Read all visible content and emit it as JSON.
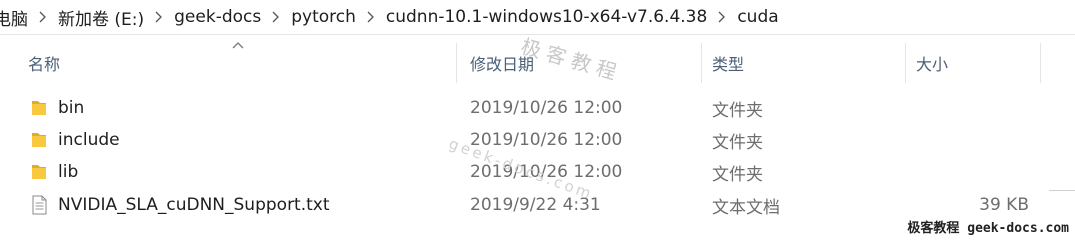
{
  "breadcrumb": [
    {
      "label": "电脑"
    },
    {
      "label": "新加卷 (E:)"
    },
    {
      "label": "geek-docs"
    },
    {
      "label": "pytorch"
    },
    {
      "label": "cudnn-10.1-windows10-x64-v7.6.4.38"
    },
    {
      "label": "cuda"
    }
  ],
  "columns": {
    "name": "名称",
    "modified": "修改日期",
    "type": "类型",
    "size": "大小"
  },
  "rows": [
    {
      "name": "bin",
      "modified": "2019/10/26 12:00",
      "type": "文件夹",
      "size": "",
      "icon": "folder-icon"
    },
    {
      "name": "include",
      "modified": "2019/10/26 12:00",
      "type": "文件夹",
      "size": "",
      "icon": "folder-icon"
    },
    {
      "name": "lib",
      "modified": "2019/10/26 12:00",
      "type": "文件夹",
      "size": "",
      "icon": "folder-icon"
    },
    {
      "name": "NVIDIA_SLA_cuDNN_Support.txt",
      "modified": "2019/9/22 4:31",
      "type": "文本文档",
      "size": "39 KB",
      "icon": "text-file-icon"
    }
  ],
  "watermark": {
    "text_cn": "极客教程",
    "text_en": "geek-docs.com",
    "brand": "极客教程 geek-docs.com"
  },
  "colors": {
    "folder": "#f8c93f",
    "folder_dark": "#e4a92a",
    "header_text": "#4c607a",
    "meta_text": "#6d6d6d"
  }
}
